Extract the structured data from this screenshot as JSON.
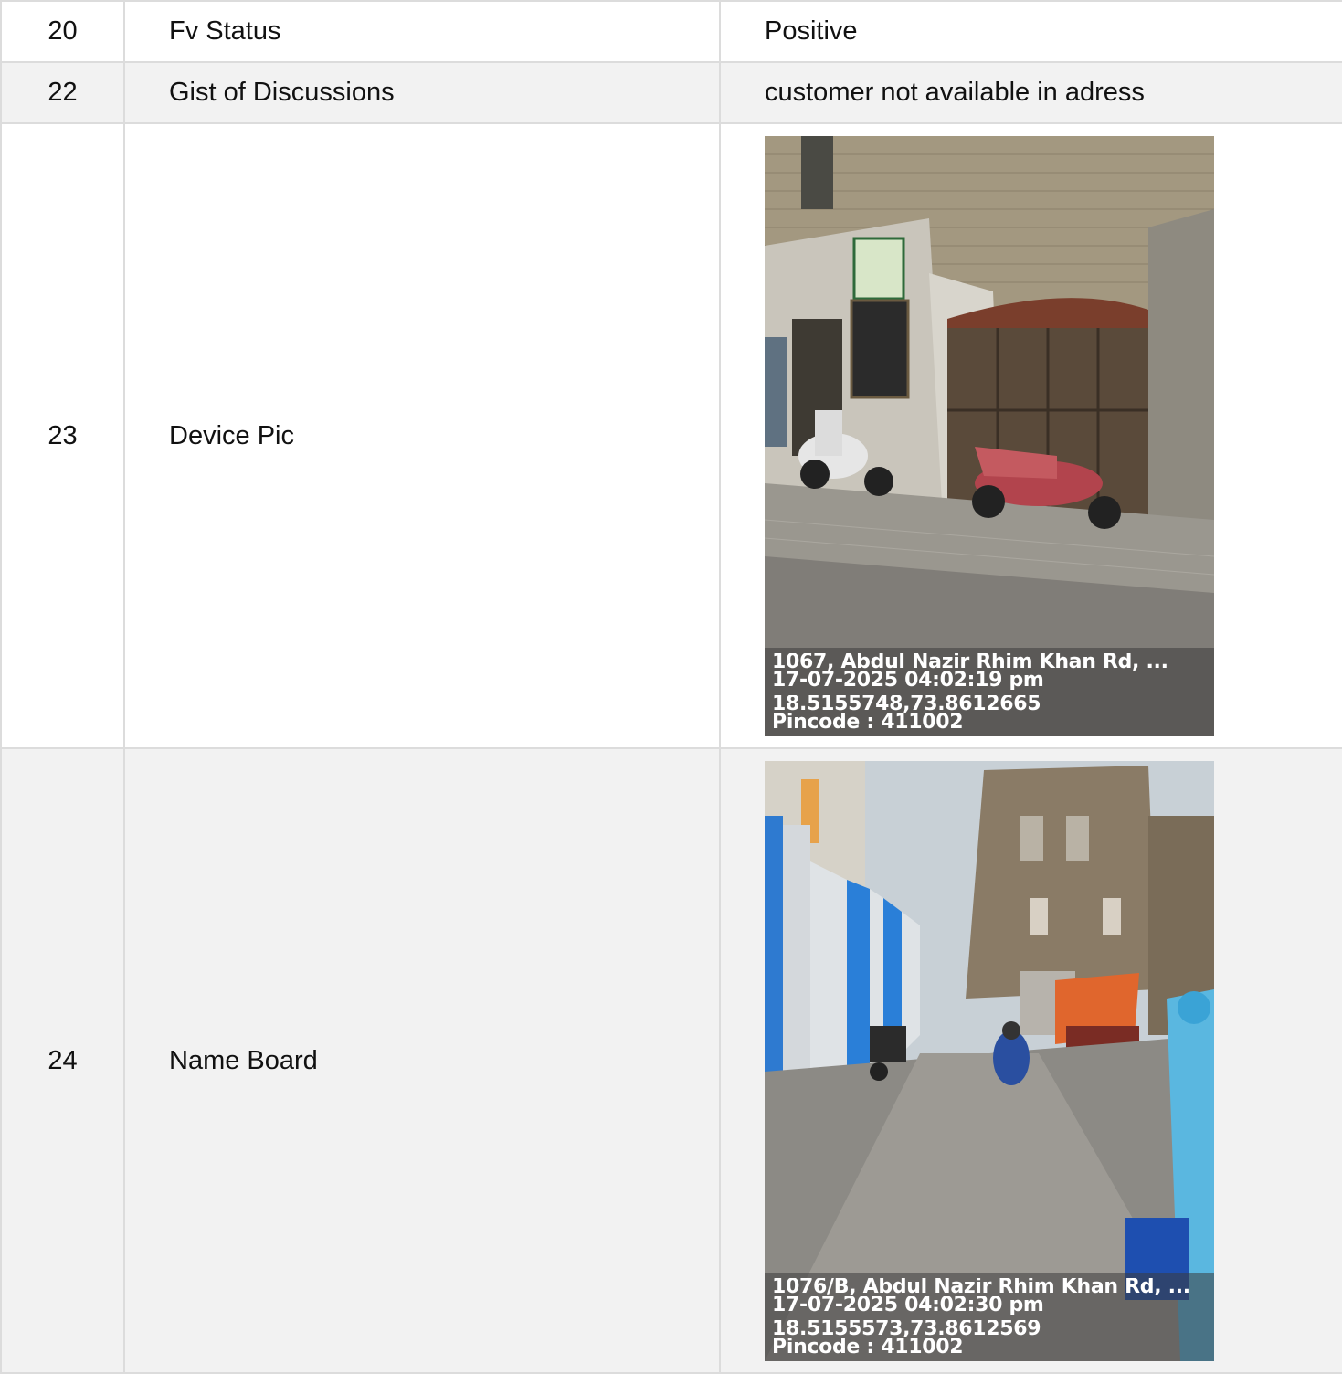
{
  "rows": [
    {
      "num": "20",
      "label": "Fv Status",
      "value": "Positive"
    },
    {
      "num": "22",
      "label": "Gist of Discussions",
      "value": "customer not available in adress"
    },
    {
      "num": "23",
      "label": "Device Pic",
      "photo": {
        "address": "1067, Abdul Nazir Rhim Khan Rd, ...",
        "datetime": "17-07-2025 04:02:19 pm",
        "coords": "18.5155748,73.8612665",
        "pincode": "Pincode : 411002"
      }
    },
    {
      "num": "24",
      "label": "Name Board",
      "photo": {
        "address": "1076/B, Abdul Nazir Rhim Khan Rd, ...",
        "datetime": "17-07-2025 04:02:30 pm",
        "coords": "18.5155573,73.8612569",
        "pincode": "Pincode : 411002"
      }
    }
  ],
  "colors": {
    "border": "#dcdcdc",
    "row_alt": "#f2f2f2",
    "text": "#111111"
  }
}
